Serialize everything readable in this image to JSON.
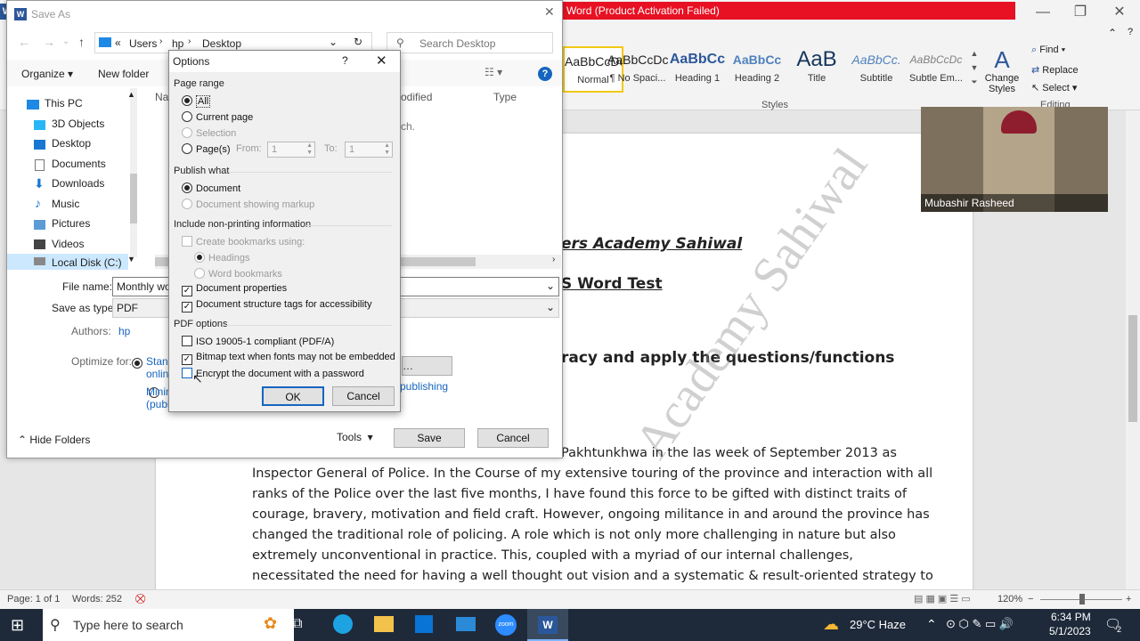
{
  "word": {
    "activation_title": "Word (Product Activation Failed)",
    "ribbon": {
      "styles": [
        {
          "preview": "AaBbCcDc",
          "name": "Normal"
        },
        {
          "preview": "AaBbCcDc",
          "name": "¶ No Spaci..."
        },
        {
          "preview": "AaBbCc",
          "name": "Heading 1"
        },
        {
          "preview": "AaBbCc",
          "name": "Heading 2"
        },
        {
          "preview": "AaB",
          "name": "Title"
        },
        {
          "preview": "AaBbCc.",
          "name": "Subtitle"
        },
        {
          "preview": "AaBbCcDc",
          "name": "Subtle Em..."
        }
      ],
      "change_styles": "Change Styles",
      "styles_group": "Styles",
      "find": "Find",
      "replace": "Replace",
      "select": "Select",
      "editing_group": "Editing"
    },
    "webcam_name": "Mubashir Rasheed",
    "doc": {
      "heading1": "ers Academy Sahiwal",
      "heading2": "S Word Test",
      "heading3": "racy and apply the questions/functions",
      "lines": [
        "Pakhtunkhwa in the las week of September 2013 as",
        "Inspector General of Police. In the Course of my extensive touring of the province and interaction with all",
        "ranks of the Police over the last five months, I have found this force to be gifted with distinct traits of",
        "courage, bravery, motivation and field craft. However, ongoing militance in and around the province has",
        "changed the traditional role of policing. A role which is not only more challenging in nature but also",
        "extremely unconventional in practice. This, coupled with a myriad of our internal challenges,",
        "necessitated the need for having a well thought out vision and a systematic & result-oriented strategy to"
      ],
      "watermark": "Academy Sahiwal"
    },
    "status": {
      "page": "Page: 1 of 1",
      "words": "Words: 252",
      "zoom": "120%"
    }
  },
  "saveas": {
    "title": "Save As",
    "breadcrumb": [
      "Users",
      "hp",
      "Desktop"
    ],
    "search_placeholder": "Search Desktop",
    "organize": "Organize",
    "new_folder": "New folder",
    "col_name": "Na",
    "col_modified": "odified",
    "col_type": "Type",
    "empty_text": "ch.",
    "nav": [
      "This PC",
      "3D Objects",
      "Desktop",
      "Documents",
      "Downloads",
      "Music",
      "Pictures",
      "Videos",
      "Local Disk (C:)"
    ],
    "file_name_label": "File name:",
    "file_name_value": "Monthly wo",
    "save_type_label": "Save as type:",
    "save_type_value": "PDF",
    "authors_label": "Authors:",
    "authors_value": "hp",
    "optimize_label": "Optimize for:",
    "optimize_std": "Stand",
    "optimize_std2": "onlin",
    "optimize_min": "Minin",
    "optimize_min2": "(publ",
    "publishing": "publishing",
    "hide_folders": "Hide Folders",
    "tools": "Tools",
    "save": "Save",
    "cancel": "Cancel"
  },
  "options": {
    "title": "Options",
    "help": "?",
    "page_range": "Page range",
    "all": "All",
    "current_page": "Current page",
    "selection": "Selection",
    "pages": "Page(s)",
    "from": "From:",
    "from_val": "1",
    "to": "To:",
    "to_val": "1",
    "publish_what": "Publish what",
    "document": "Document",
    "doc_markup": "Document showing markup",
    "nonprinting": "Include non-printing information",
    "create_bookmarks": "Create bookmarks using:",
    "headings": "Headings",
    "word_bookmarks": "Word bookmarks",
    "doc_props": "Document properties",
    "doc_tags": "Document structure tags for accessibility",
    "pdf_options": "PDF options",
    "iso": "ISO 19005-1 compliant (PDF/A)",
    "bitmap": "Bitmap text when fonts may not be embedded",
    "encrypt": "Encrypt the document with a password",
    "ok": "OK",
    "cancel": "Cancel"
  },
  "taskbar": {
    "search_placeholder": "Type here to search",
    "weather": "29°C  Haze",
    "time": "6:34 PM",
    "date": "5/1/2023",
    "notifications": "2"
  }
}
